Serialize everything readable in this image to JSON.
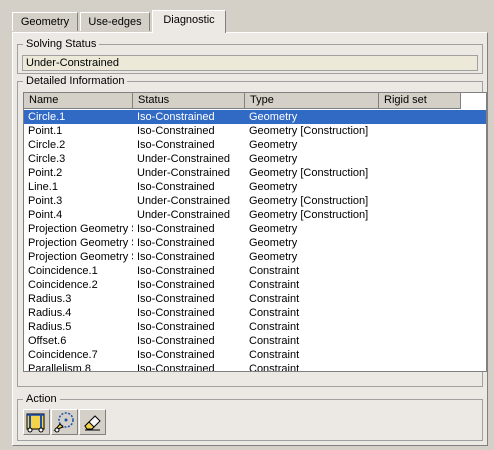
{
  "tabs": [
    {
      "label": "Geometry"
    },
    {
      "label": "Use-edges"
    },
    {
      "label": "Diagnostic"
    }
  ],
  "solving_status": {
    "title": "Solving Status",
    "value": "Under-Constrained"
  },
  "detailed_information": {
    "title": "Detailed Information",
    "columns": [
      "Name",
      "Status",
      "Type",
      "Rigid set"
    ],
    "rows": [
      {
        "name": "Circle.1",
        "status": "Iso-Constrained",
        "type": "Geometry",
        "selected": true
      },
      {
        "name": "Point.1",
        "status": "Iso-Constrained",
        "type": "Geometry [Construction]"
      },
      {
        "name": "Circle.2",
        "status": "Iso-Constrained",
        "type": "Geometry"
      },
      {
        "name": "Circle.3",
        "status": "Under-Constrained",
        "type": "Geometry"
      },
      {
        "name": "Point.2",
        "status": "Under-Constrained",
        "type": "Geometry [Construction]"
      },
      {
        "name": "Line.1",
        "status": "Iso-Constrained",
        "type": "Geometry"
      },
      {
        "name": "Point.3",
        "status": "Under-Constrained",
        "type": "Geometry [Construction]"
      },
      {
        "name": "Point.4",
        "status": "Under-Constrained",
        "type": "Geometry [Construction]"
      },
      {
        "name": "Projection Geometry S",
        "status": "Iso-Constrained",
        "type": "Geometry"
      },
      {
        "name": "Projection Geometry S",
        "status": "Iso-Constrained",
        "type": "Geometry"
      },
      {
        "name": "Projection Geometry S",
        "status": "Iso-Constrained",
        "type": "Geometry"
      },
      {
        "name": "Coincidence.1",
        "status": "Iso-Constrained",
        "type": "Constraint"
      },
      {
        "name": "Coincidence.2",
        "status": "Iso-Constrained",
        "type": "Constraint"
      },
      {
        "name": "Radius.3",
        "status": "Iso-Constrained",
        "type": "Constraint"
      },
      {
        "name": "Radius.4",
        "status": "Iso-Constrained",
        "type": "Constraint"
      },
      {
        "name": "Radius.5",
        "status": "Iso-Constrained",
        "type": "Constraint"
      },
      {
        "name": "Offset.6",
        "status": "Iso-Constrained",
        "type": "Constraint"
      },
      {
        "name": "Coincidence.7",
        "status": "Iso-Constrained",
        "type": "Constraint"
      },
      {
        "name": "Parallelism.8",
        "status": "Iso-Constrained",
        "type": "Constraint"
      }
    ]
  },
  "action": {
    "title": "Action",
    "buttons": [
      {
        "icon": "reconcile-icon"
      },
      {
        "icon": "fix-constraints-icon"
      },
      {
        "icon": "eraser-icon"
      }
    ]
  },
  "colors": {
    "selection": "#316ac5",
    "panel": "#ece9e4",
    "chrome": "#d4d0c8"
  }
}
